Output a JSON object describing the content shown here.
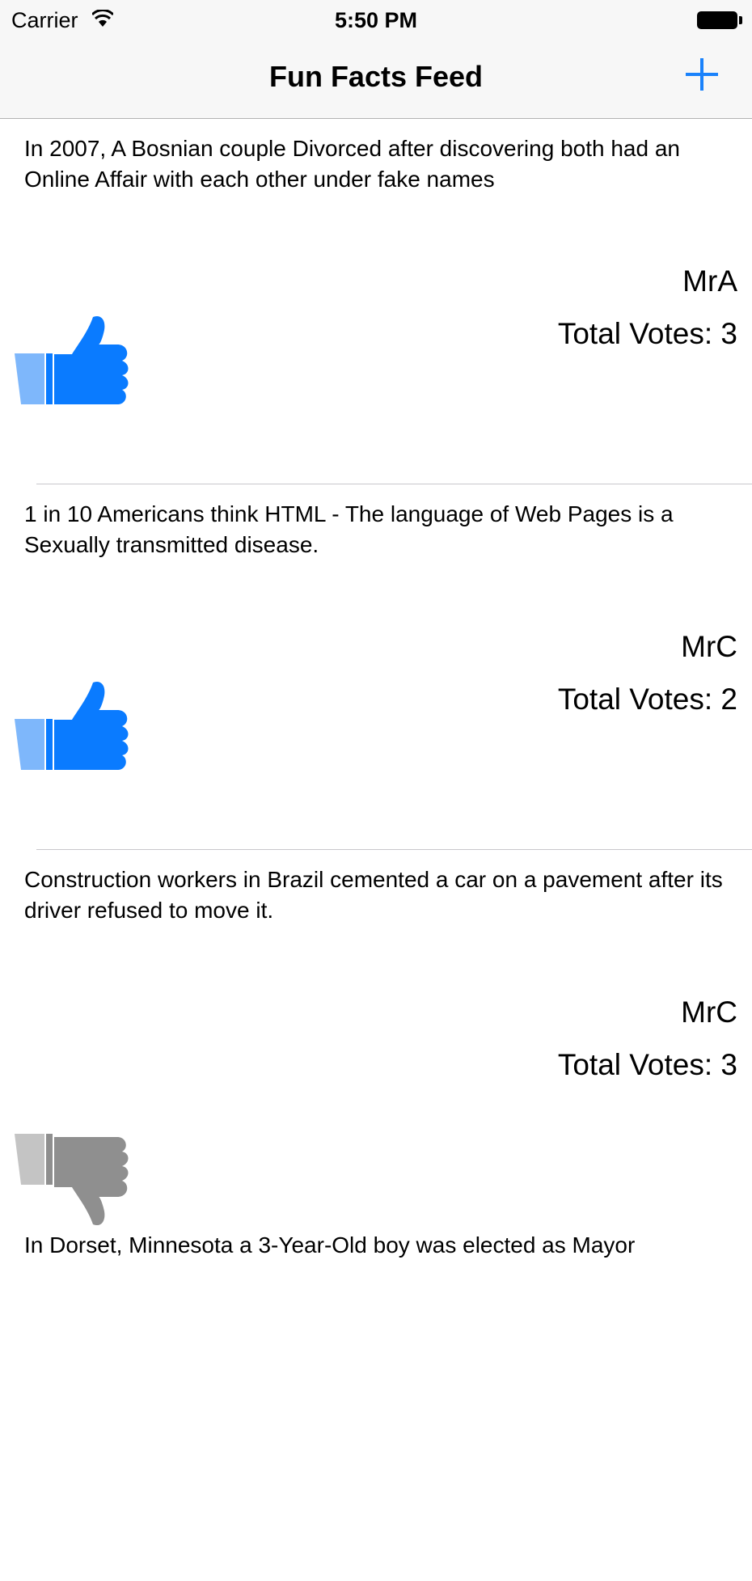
{
  "status_bar": {
    "carrier": "Carrier",
    "time": "5:50 PM"
  },
  "nav": {
    "title": "Fun Facts Feed",
    "add_icon": "plus-icon"
  },
  "colors": {
    "accent": "#1a82fb",
    "vote_up": "#0a7bff",
    "vote_down": "#8f8f8f"
  },
  "facts": [
    {
      "text": "In 2007, A Bosnian couple Divorced after discovering both had an Online Affair with each other under fake names",
      "author": "MrA",
      "votes": "Total Votes: 3",
      "vote_icon": "thumbs-up-icon"
    },
    {
      "text": "1 in 10 Americans think HTML - The language of Web Pages is a Sexually transmitted disease.",
      "author": "MrC",
      "votes": "Total Votes: 2",
      "vote_icon": "thumbs-up-icon"
    },
    {
      "text": "Construction workers in Brazil cemented a car on a pavement after its driver refused to move it.",
      "author": "MrC",
      "votes": "Total Votes: 3",
      "vote_icon": "thumbs-down-icon"
    },
    {
      "text": "In Dorset, Minnesota a 3-Year-Old boy was elected as Mayor"
    }
  ]
}
